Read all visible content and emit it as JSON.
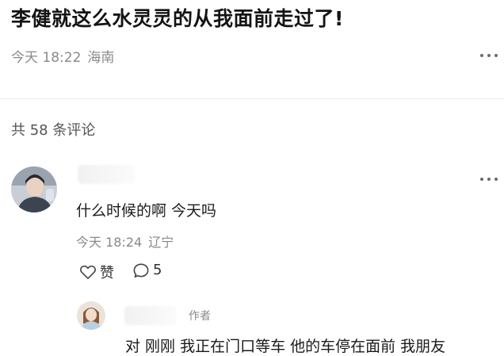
{
  "post": {
    "title": "李健就这么水灵灵的从我面前走过了!",
    "date": "今天 18:22",
    "location": "海南",
    "more_icon": "more-dots-icon"
  },
  "comments_header": {
    "label": "共 58 条评论"
  },
  "comments": [
    {
      "avatar_icon": "user-avatar",
      "text": "什么时候的啊 今天吗",
      "date": "今天 18:24",
      "location": "辽宁",
      "like_label": "赞",
      "like_icon": "heart-outline-icon",
      "reply_icon": "comment-bubble-icon",
      "reply_count": "5"
    }
  ],
  "reply": {
    "avatar_icon": "user-avatar",
    "author_tag": "作者",
    "text": "对 刚刚 我正在门口等车 他的车停在面前 我朋友"
  }
}
